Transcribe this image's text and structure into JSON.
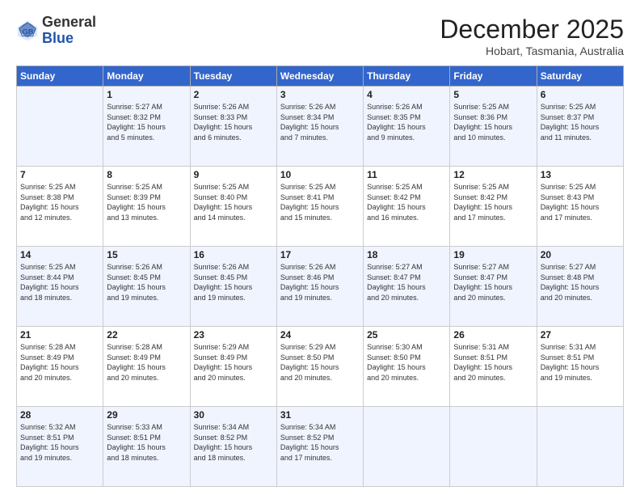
{
  "header": {
    "logo_general": "General",
    "logo_blue": "Blue",
    "month": "December 2025",
    "location": "Hobart, Tasmania, Australia"
  },
  "weekdays": [
    "Sunday",
    "Monday",
    "Tuesday",
    "Wednesday",
    "Thursday",
    "Friday",
    "Saturday"
  ],
  "weeks": [
    [
      {
        "day": "",
        "info": ""
      },
      {
        "day": "1",
        "info": "Sunrise: 5:27 AM\nSunset: 8:32 PM\nDaylight: 15 hours\nand 5 minutes."
      },
      {
        "day": "2",
        "info": "Sunrise: 5:26 AM\nSunset: 8:33 PM\nDaylight: 15 hours\nand 6 minutes."
      },
      {
        "day": "3",
        "info": "Sunrise: 5:26 AM\nSunset: 8:34 PM\nDaylight: 15 hours\nand 7 minutes."
      },
      {
        "day": "4",
        "info": "Sunrise: 5:26 AM\nSunset: 8:35 PM\nDaylight: 15 hours\nand 9 minutes."
      },
      {
        "day": "5",
        "info": "Sunrise: 5:25 AM\nSunset: 8:36 PM\nDaylight: 15 hours\nand 10 minutes."
      },
      {
        "day": "6",
        "info": "Sunrise: 5:25 AM\nSunset: 8:37 PM\nDaylight: 15 hours\nand 11 minutes."
      }
    ],
    [
      {
        "day": "7",
        "info": "Sunrise: 5:25 AM\nSunset: 8:38 PM\nDaylight: 15 hours\nand 12 minutes."
      },
      {
        "day": "8",
        "info": "Sunrise: 5:25 AM\nSunset: 8:39 PM\nDaylight: 15 hours\nand 13 minutes."
      },
      {
        "day": "9",
        "info": "Sunrise: 5:25 AM\nSunset: 8:40 PM\nDaylight: 15 hours\nand 14 minutes."
      },
      {
        "day": "10",
        "info": "Sunrise: 5:25 AM\nSunset: 8:41 PM\nDaylight: 15 hours\nand 15 minutes."
      },
      {
        "day": "11",
        "info": "Sunrise: 5:25 AM\nSunset: 8:42 PM\nDaylight: 15 hours\nand 16 minutes."
      },
      {
        "day": "12",
        "info": "Sunrise: 5:25 AM\nSunset: 8:42 PM\nDaylight: 15 hours\nand 17 minutes."
      },
      {
        "day": "13",
        "info": "Sunrise: 5:25 AM\nSunset: 8:43 PM\nDaylight: 15 hours\nand 17 minutes."
      }
    ],
    [
      {
        "day": "14",
        "info": "Sunrise: 5:25 AM\nSunset: 8:44 PM\nDaylight: 15 hours\nand 18 minutes."
      },
      {
        "day": "15",
        "info": "Sunrise: 5:26 AM\nSunset: 8:45 PM\nDaylight: 15 hours\nand 19 minutes."
      },
      {
        "day": "16",
        "info": "Sunrise: 5:26 AM\nSunset: 8:45 PM\nDaylight: 15 hours\nand 19 minutes."
      },
      {
        "day": "17",
        "info": "Sunrise: 5:26 AM\nSunset: 8:46 PM\nDaylight: 15 hours\nand 19 minutes."
      },
      {
        "day": "18",
        "info": "Sunrise: 5:27 AM\nSunset: 8:47 PM\nDaylight: 15 hours\nand 20 minutes."
      },
      {
        "day": "19",
        "info": "Sunrise: 5:27 AM\nSunset: 8:47 PM\nDaylight: 15 hours\nand 20 minutes."
      },
      {
        "day": "20",
        "info": "Sunrise: 5:27 AM\nSunset: 8:48 PM\nDaylight: 15 hours\nand 20 minutes."
      }
    ],
    [
      {
        "day": "21",
        "info": "Sunrise: 5:28 AM\nSunset: 8:49 PM\nDaylight: 15 hours\nand 20 minutes."
      },
      {
        "day": "22",
        "info": "Sunrise: 5:28 AM\nSunset: 8:49 PM\nDaylight: 15 hours\nand 20 minutes."
      },
      {
        "day": "23",
        "info": "Sunrise: 5:29 AM\nSunset: 8:49 PM\nDaylight: 15 hours\nand 20 minutes."
      },
      {
        "day": "24",
        "info": "Sunrise: 5:29 AM\nSunset: 8:50 PM\nDaylight: 15 hours\nand 20 minutes."
      },
      {
        "day": "25",
        "info": "Sunrise: 5:30 AM\nSunset: 8:50 PM\nDaylight: 15 hours\nand 20 minutes."
      },
      {
        "day": "26",
        "info": "Sunrise: 5:31 AM\nSunset: 8:51 PM\nDaylight: 15 hours\nand 20 minutes."
      },
      {
        "day": "27",
        "info": "Sunrise: 5:31 AM\nSunset: 8:51 PM\nDaylight: 15 hours\nand 19 minutes."
      }
    ],
    [
      {
        "day": "28",
        "info": "Sunrise: 5:32 AM\nSunset: 8:51 PM\nDaylight: 15 hours\nand 19 minutes."
      },
      {
        "day": "29",
        "info": "Sunrise: 5:33 AM\nSunset: 8:51 PM\nDaylight: 15 hours\nand 18 minutes."
      },
      {
        "day": "30",
        "info": "Sunrise: 5:34 AM\nSunset: 8:52 PM\nDaylight: 15 hours\nand 18 minutes."
      },
      {
        "day": "31",
        "info": "Sunrise: 5:34 AM\nSunset: 8:52 PM\nDaylight: 15 hours\nand 17 minutes."
      },
      {
        "day": "",
        "info": ""
      },
      {
        "day": "",
        "info": ""
      },
      {
        "day": "",
        "info": ""
      }
    ]
  ]
}
